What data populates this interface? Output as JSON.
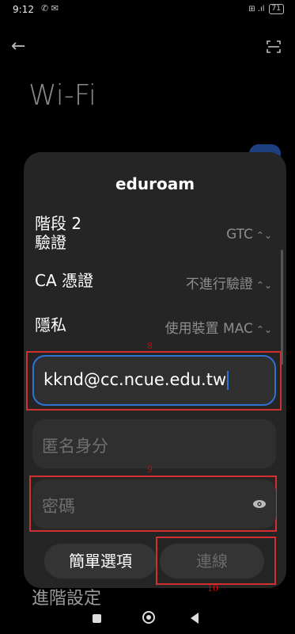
{
  "status_bar": {
    "time": "9:12",
    "left_icons": "✆ ✉",
    "signal": "⊞ .ıl",
    "battery": "71"
  },
  "page": {
    "title": "Wi-Fi",
    "advanced_settings": "進階設定"
  },
  "dialog": {
    "title": "eduroam",
    "rows": [
      {
        "label": "階段 2\n驗證",
        "value": "GTC"
      },
      {
        "label": "CA 憑證",
        "value": "不進行驗證"
      },
      {
        "label": "隱私",
        "value": "使用裝置 MAC"
      }
    ],
    "identity_value": "kknd@cc.ncue.edu.tw",
    "anonymous_placeholder": "匿名身分",
    "password_placeholder": "密碼",
    "buttons": {
      "simple": "簡單選項",
      "connect": "連線"
    }
  },
  "annotations": [
    "8",
    "9",
    "10"
  ],
  "colors": {
    "accent": "#2f72d6",
    "annotation_red": "#d23030",
    "dialog_bg": "#252525",
    "field_bg": "#2f2f2f"
  },
  "icons": {
    "back": "arrow-left",
    "scan": "qr-scan",
    "chevron": "chevron-updown",
    "eye": "eye"
  }
}
